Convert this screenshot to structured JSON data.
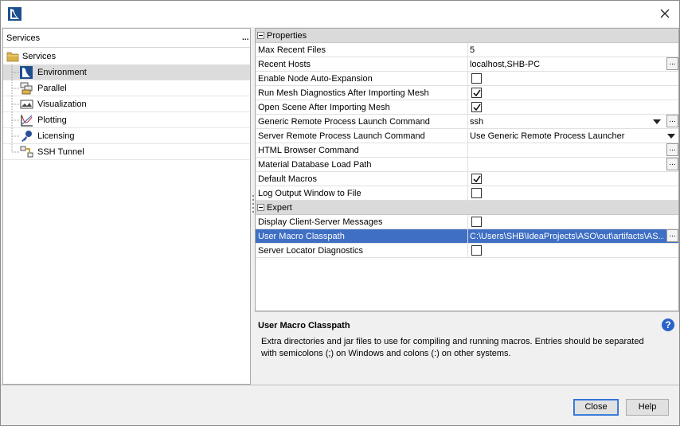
{
  "window": {
    "close_icon": "close-icon",
    "app_icon": "star-ccm-logo-icon"
  },
  "left": {
    "header": "Services",
    "more": "...",
    "root": {
      "label": "Services",
      "icon": "folder-icon"
    },
    "items": [
      {
        "label": "Environment",
        "icon": "environment-icon",
        "selected": true
      },
      {
        "label": "Parallel",
        "icon": "parallel-icon",
        "selected": false
      },
      {
        "label": "Visualization",
        "icon": "visualization-icon",
        "selected": false
      },
      {
        "label": "Plotting",
        "icon": "plotting-icon",
        "selected": false
      },
      {
        "label": "Licensing",
        "icon": "key-icon",
        "selected": false
      },
      {
        "label": "SSH Tunnel",
        "icon": "ssh-tunnel-icon",
        "selected": false
      }
    ]
  },
  "grid": {
    "sections": [
      {
        "label": "Properties",
        "rows": [
          {
            "name": "Max Recent Files",
            "type": "text",
            "value": "5"
          },
          {
            "name": "Recent Hosts",
            "type": "text-ellipsis",
            "value": "localhost,SHB-PC"
          },
          {
            "name": "Enable Node Auto-Expansion",
            "type": "check",
            "checked": false
          },
          {
            "name": "Run Mesh Diagnostics After Importing Mesh",
            "type": "check",
            "checked": true
          },
          {
            "name": "Open Scene After Importing Mesh",
            "type": "check",
            "checked": true
          },
          {
            "name": "Generic Remote Process Launch Command",
            "type": "dropdown-ellipsis",
            "value": "ssh"
          },
          {
            "name": "Server Remote Process Launch Command",
            "type": "dropdown",
            "value": "Use Generic Remote Process Launcher"
          },
          {
            "name": "HTML Browser Command",
            "type": "text-ellipsis",
            "value": ""
          },
          {
            "name": "Material Database Load Path",
            "type": "text-ellipsis",
            "value": ""
          },
          {
            "name": "Default Macros",
            "type": "check",
            "checked": true
          },
          {
            "name": "Log Output Window to File",
            "type": "check",
            "checked": false
          }
        ]
      },
      {
        "label": "Expert",
        "rows": [
          {
            "name": "Display Client-Server Messages",
            "type": "check",
            "checked": false
          },
          {
            "name": "User Macro Classpath",
            "type": "text-ellipsis",
            "value": "C:\\Users\\SHB\\IdeaProjects\\ASO\\out\\artifacts\\AS...",
            "selected": true
          },
          {
            "name": "Server Locator Diagnostics",
            "type": "check",
            "checked": false
          }
        ]
      }
    ]
  },
  "description": {
    "title": "User Macro Classpath",
    "body": "Extra directories and jar files to use for compiling and running macros. Entries should be separated with semicolons (;) on Windows and colons (:) on other systems.",
    "help_icon": "help-icon"
  },
  "footer": {
    "close_label": "Close",
    "help_label": "Help"
  },
  "colors": {
    "selection": "#3f6fc4",
    "help_blue": "#2a62c9"
  }
}
